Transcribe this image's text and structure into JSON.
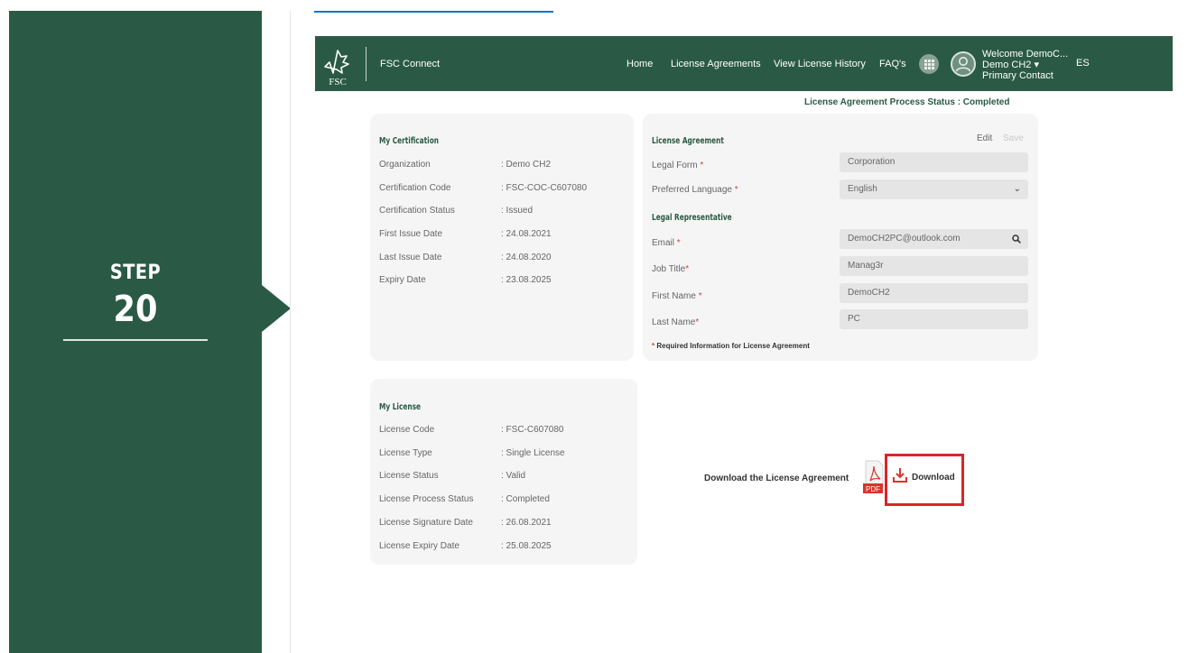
{
  "step": {
    "label": "STEP",
    "number": "20"
  },
  "header": {
    "logo_text": "FSC",
    "app_name": "FSC Connect",
    "nav": [
      "Home",
      "License Agreements",
      "View License History",
      "FAQ's"
    ],
    "welcome_line1": "Welcome DemoC...",
    "welcome_line2": "Demo CH2 ▾",
    "welcome_line3": "Primary Contact",
    "language": "ES",
    "icons": {
      "logo": "fsc-tree-logo",
      "apps": "grid-icon",
      "user": "user-avatar-icon"
    },
    "colors": {
      "brand": "#2a5a45"
    }
  },
  "process_status": "License Agreement Process Status : Completed",
  "certification": {
    "title": "My Certification",
    "rows": [
      {
        "label": "Organization",
        "value": ": Demo CH2"
      },
      {
        "label": "Certification Code",
        "value": ": FSC-COC-C607080"
      },
      {
        "label": "Certification Status",
        "value": ": Issued"
      },
      {
        "label": "First Issue Date",
        "value": ": 24.08.2021"
      },
      {
        "label": "Last Issue Date",
        "value": ": 24.08.2020"
      },
      {
        "label": "Expiry Date",
        "value": ": 23.08.2025"
      }
    ]
  },
  "agreement": {
    "title": "License Agreement",
    "edit_label": "Edit",
    "save_label": "Save",
    "legal_form_label": "Legal Form",
    "legal_form_value": "Corporation",
    "language_label": "Preferred Language",
    "language_value": "English",
    "rep_title": "Legal Representative",
    "email_label": "Email",
    "email_value": "DemoCH2PC@outlook.com",
    "job_label": "Job Title",
    "job_value": "Manag3r",
    "first_label": "First Name",
    "first_value": "DemoCH2",
    "last_label": "Last Name",
    "last_value": "PC",
    "required_marker": "*",
    "note": "Required Information for License Agreement"
  },
  "license": {
    "title": "My License",
    "rows": [
      {
        "label": "License Code",
        "value": ": FSC-C607080"
      },
      {
        "label": "License Type",
        "value": ": Single License"
      },
      {
        "label": "License Status",
        "value": ": Valid"
      },
      {
        "label": "License Process Status",
        "value": ": Completed"
      },
      {
        "label": "License Signature Date",
        "value": ": 26.08.2021"
      },
      {
        "label": "License Expiry Date",
        "value": ": 25.08.2025"
      }
    ]
  },
  "download": {
    "label": "Download the License Agreement",
    "pdf_text": "PDF",
    "button": "Download",
    "highlight_color": "#d9252a"
  }
}
